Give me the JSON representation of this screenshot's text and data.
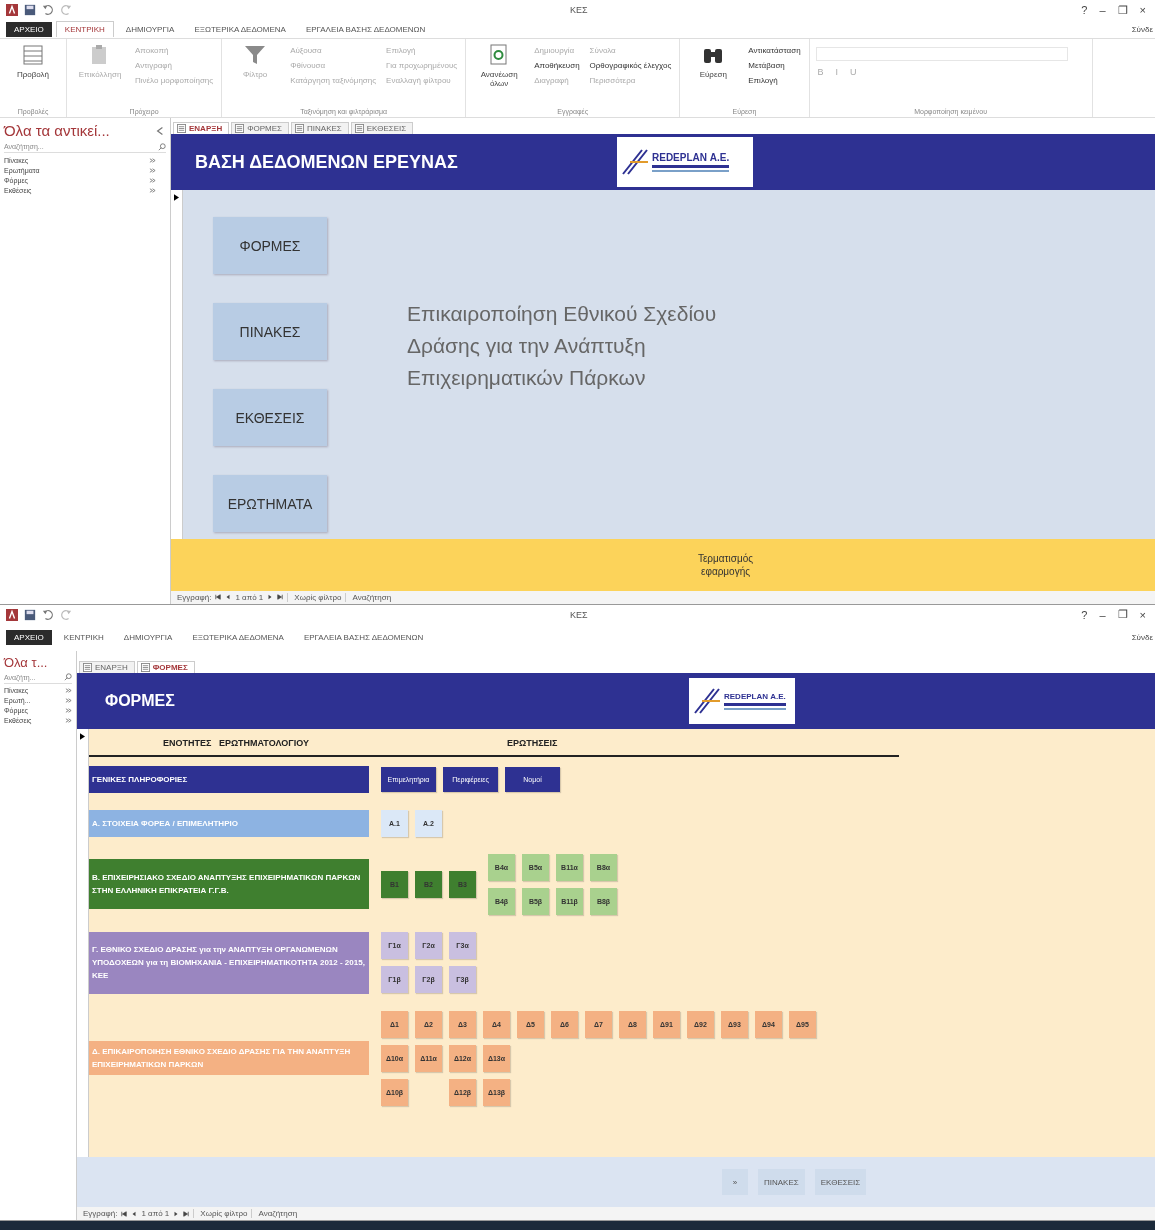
{
  "windows": [
    {
      "title": "ΚΕΣ",
      "controls": [
        "?",
        "–",
        "❐",
        "×"
      ],
      "account": "Σύνδε",
      "ribbon_tabs": [
        {
          "label": "ΑΡΧΕΙΟ",
          "kind": "file",
          "selected": false
        },
        {
          "label": "ΚΕΝΤΡΙΚΗ",
          "kind": "tab",
          "selected": true
        },
        {
          "label": "ΔΗΜΙΟΥΡΓΙΑ",
          "kind": "tab",
          "selected": false
        },
        {
          "label": "ΕΞΩΤΕΡΙΚΑ ΔΕΔΟΜΕΝΑ",
          "kind": "tab",
          "selected": false
        },
        {
          "label": "ΕΡΓΑΛΕΙΑ ΒΑΣΗΣ ΔΕΔΟΜΕΝΩΝ",
          "kind": "tab",
          "selected": false
        }
      ],
      "ribbon": {
        "groups": [
          {
            "label": "Προβολές",
            "large": {
              "label": "Προβολή",
              "disabled": false
            }
          },
          {
            "label": "Πρόχειρο",
            "large": {
              "label": "Επικόλληση",
              "disabled": true
            },
            "columns": [
              [
                {
                  "label": "Αποκοπή",
                  "disabled": true
                },
                {
                  "label": "Αντιγραφή",
                  "disabled": true
                },
                {
                  "label": "Πινέλο μορφοποίησης",
                  "disabled": true
                }
              ]
            ]
          },
          {
            "label": "Ταξινόμηση και φιλτράρισμα",
            "large": {
              "label": "Φίλτρο",
              "disabled": true
            },
            "columns": [
              [
                {
                  "label": "Αύξουσα",
                  "disabled": true
                },
                {
                  "label": "Φθίνουσα",
                  "disabled": true
                },
                {
                  "label": "Κατάργηση ταξινόμησης",
                  "disabled": true
                }
              ],
              [
                {
                  "label": "Επιλογή",
                  "disabled": true
                },
                {
                  "label": "Για προχωρημένους",
                  "disabled": true
                },
                {
                  "label": "Εναλλαγή φίλτρου",
                  "disabled": true
                }
              ]
            ]
          },
          {
            "label": "Εγγραφές",
            "large": {
              "label": "Ανανέωση όλων",
              "disabled": false
            },
            "columns": [
              [
                {
                  "label": "Δημιουργία",
                  "disabled": true
                },
                {
                  "label": "Αποθήκευση",
                  "disabled": false
                },
                {
                  "label": "Διαγραφή",
                  "disabled": true
                }
              ],
              [
                {
                  "label": "Σύνολα",
                  "disabled": true
                },
                {
                  "label": "Ορθογραφικός έλεγχος",
                  "disabled": false
                },
                {
                  "label": "Περισσότερα",
                  "disabled": true
                }
              ]
            ]
          },
          {
            "label": "Εύρεση",
            "large": {
              "label": "Εύρεση",
              "disabled": false
            },
            "columns": [
              [
                {
                  "label": "Αντικατάσταση",
                  "disabled": false
                },
                {
                  "label": "Μετάβαση",
                  "disabled": false
                },
                {
                  "label": "Επιλογή",
                  "disabled": false
                }
              ]
            ]
          },
          {
            "label": "Μορφοποίηση κειμένου",
            "format": [
              {
                "label": "B",
                "disabled": true
              },
              {
                "label": "I",
                "disabled": true
              },
              {
                "label": "U",
                "disabled": true
              }
            ]
          }
        ]
      },
      "nav_pane": {
        "title": "Όλα τα αντικεί...",
        "search": {
          "placeholder": "Αναζήτηση..."
        },
        "items": [
          "Πίνακες",
          "Ερωτήματα",
          "Φόρμες",
          "Εκθέσεις"
        ]
      },
      "doc_tabs": [
        {
          "label": "ΕΝΑΡΞΗ",
          "selected": true
        },
        {
          "label": "ΦΟΡΜΕΣ",
          "selected": false
        },
        {
          "label": "ΠΙΝΑΚΕΣ",
          "selected": false
        },
        {
          "label": "ΕΚΘΕΣΕΙΣ",
          "selected": false
        }
      ],
      "form": {
        "kind": "start",
        "title": "ΒΑΣΗ  ΔΕΔΟΜΕΝΩΝ ΕΡΕΥΝΑΣ",
        "logo": "REDEPLAN Α.Ε.",
        "menu": [
          "ΦΟΡΜΕΣ",
          "ΠΙΝΑΚΕΣ",
          "ΕΚΘΕΣΕΙΣ",
          "ΕΡΩΤΗΜΑΤΑ"
        ],
        "headline": [
          "Επικαιροποίηση Εθνικού Σχεδίου",
          "Δράσης για την Ανάπτυξη",
          "Επιχειρηματικών Πάρκων"
        ],
        "footer_buttons": [
          "Τερματισμός εφαρμογής"
        ]
      },
      "record_nav": {
        "label": "Εγγραφή:",
        "position": "1 από 1",
        "filter": "Χωρίς φίλτρο",
        "search": "Αναζήτηση"
      }
    },
    {
      "title": "ΚΕΣ",
      "controls": [
        "?",
        "–",
        "❐",
        "×"
      ],
      "account": "Σύνδε",
      "ribbon_tabs": [
        {
          "label": "ΑΡΧΕΙΟ",
          "kind": "file",
          "selected": false
        },
        {
          "label": "ΚΕΝΤΡΙΚΗ",
          "kind": "tab",
          "selected": false
        },
        {
          "label": "ΔΗΜΙΟΥΡΓΙΑ",
          "kind": "tab",
          "selected": false
        },
        {
          "label": "ΕΞΩΤΕΡΙΚΑ ΔΕΔΟΜΕΝΑ",
          "kind": "tab",
          "selected": false
        },
        {
          "label": "ΕΡΓΑΛΕΙΑ ΒΑΣΗΣ ΔΕΔΟΜΕΝΩΝ",
          "kind": "tab",
          "selected": false
        }
      ],
      "nav_pane": {
        "title": "Όλα τ...",
        "search": {
          "placeholder": "Αναζήτη..."
        },
        "items": [
          "Πίνακες",
          "Ερωτή...",
          "Φόρμες",
          "Εκθέσεις"
        ]
      },
      "doc_tabs": [
        {
          "label": "ΕΝΑΡΞΗ",
          "selected": false
        },
        {
          "label": "ΦΟΡΜΕΣ",
          "selected": true
        }
      ],
      "form": {
        "kind": "forms",
        "title": "ΦΟΡΜΕΣ",
        "logo": "REDEPLAN Α.Ε.",
        "column_headers": [
          "ΕΝΟΤΗΤΕΣ   ΕΡΩΤΗΜΑΤΟΛΟΓΙΟΥ",
          "ΕΡΩΤΗΣΕΙΣ"
        ],
        "sections": [
          {
            "label": "ΓΕΝΙΚΕΣ  ΠΛΗΡΟΦΟΡΙΕΣ",
            "color": "#2e3192",
            "groups": [
              {
                "color": "#2e3192",
                "light_text": true,
                "rows": [
                  [
                    "Επιμελητήρια",
                    "Περιφέρειες",
                    "Νομοί"
                  ]
                ]
              }
            ]
          },
          {
            "label": "Α. ΣΤΟΙΧΕΙΑ ΦΟΡΕΑ / ΕΠΙΜΕΛΗΤΗΡΙΟ",
            "color": "#8db3e2",
            "groups": [
              {
                "color": "#dbe8f7",
                "light_text": false,
                "rows": [
                  [
                    "Α.1",
                    "Α.2"
                  ]
                ]
              }
            ]
          },
          {
            "label": "Β. ΕΠΙΧΕΙΡΗΣΙΑΚΟ ΣΧΕΔΙΟ ΑΝΑΠΤΥΞΗΣ ΕΠΙΧΕΙΡΗΜΑΤΙΚΩΝ ΠΑΡΚΩΝ ΣΤΗΝ ΕΛΛΗΝΙΚΗ ΕΠΙΚΡΑΤΕΙΑ Γ.Γ.Β.",
            "color": "#3f7f2f",
            "groups": [
              {
                "color": "#3f7f2f",
                "light_text": false,
                "rows": [
                  [
                    "Β1",
                    "Β2",
                    "Β3"
                  ]
                ]
              },
              {
                "color": "#a9d18e",
                "light_text": false,
                "rows": [
                  [
                    "Β4α",
                    "Β5α",
                    "Β11α",
                    "Β8α"
                  ],
                  [
                    "Β4β",
                    "Β5β",
                    "Β11β",
                    "Β8β"
                  ]
                ]
              }
            ]
          },
          {
            "label": "Γ. ΕΘΝΙΚΟ ΣΧΕΔΙΟ ΔΡΑΣΗΣ για την ΑΝΑΠΤΥΞΗ ΟΡΓΑΝΩΜΕΝΩΝ ΥΠΟΔΟΧΕΩΝ για τη ΒΙΟΜΗΧΑΝΙΑ - ΕΠΙΧΕΙΡΗΜΑΤΙΚΟΤΗΤΑ 2012 - 2015,  ΚΕΕ",
            "color": "#9a86c0",
            "groups": [
              {
                "color": "#c9bfe0",
                "light_text": false,
                "rows": [
                  [
                    "Γ1α",
                    "Γ2α",
                    "Γ3α"
                  ],
                  [
                    "Γ1β",
                    "Γ2β",
                    "Γ3β"
                  ]
                ]
              }
            ]
          },
          {
            "label": "Δ. ΕΠΙΚΑΙΡΟΠΟΙΗΣΗ  ΕΘΝΙΚΟ ΣΧΕΔΙΟ ΔΡΑΣΗΣ ΓΙΑ ΤΗΝ ΑΝΑΠΤΥΞΗ ΕΠΙΧΕΙΡΗΜΑΤΙΚΩΝ ΠΑΡΚΩΝ",
            "color": "#f4b183",
            "groups": [
              {
                "color": "#f4b183",
                "light_text": false,
                "rows": [
                  [
                    "Δ1",
                    "Δ2",
                    "Δ3",
                    "Δ4",
                    "Δ5",
                    "Δ6",
                    "Δ7",
                    "Δ8",
                    "Δ91",
                    "Δ92",
                    "Δ93",
                    "Δ94",
                    "Δ95"
                  ],
                  [
                    "Δ10α",
                    "Δ11α",
                    "Δ12α",
                    "Δ13α"
                  ],
                  [
                    "Δ10β",
                    null,
                    "Δ12β",
                    "Δ13β"
                  ]
                ]
              }
            ]
          }
        ],
        "footer_buttons": [
          "»",
          "ΠΙΝΑΚΕΣ",
          "ΕΚΘΕΣΕΙΣ"
        ]
      },
      "record_nav": {
        "label": "Εγγραφή:",
        "position": "1 από 1",
        "filter": "Χωρίς φίλτρο",
        "search": "Αναζήτηση"
      }
    }
  ]
}
